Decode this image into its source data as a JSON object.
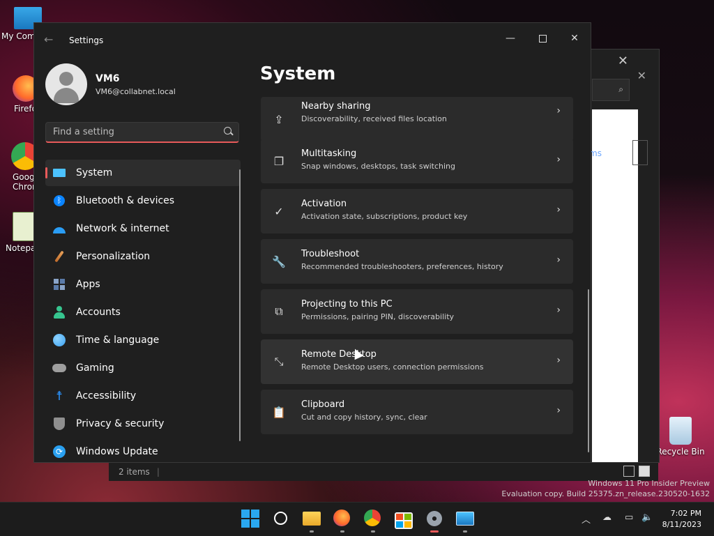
{
  "desktop": {
    "icons": [
      {
        "label": "My Com"
      },
      {
        "label": "Firefo"
      },
      {
        "label": "Goog\nChron"
      },
      {
        "label": "Notepa"
      }
    ],
    "recycle_bin": "Recycle Bin"
  },
  "background_window": {
    "link_text": "ms",
    "status_items": "2 items"
  },
  "settings": {
    "window_title": "Settings",
    "profile": {
      "name": "VM6",
      "email": "VM6@collabnet.local"
    },
    "search": {
      "placeholder": "Find a setting"
    },
    "nav": [
      {
        "label": "System",
        "icon": "monitor-icon",
        "active": true,
        "color": "#4cc2ff"
      },
      {
        "label": "Bluetooth & devices",
        "icon": "bluetooth-icon",
        "color": "#0a84ff"
      },
      {
        "label": "Network & internet",
        "icon": "wifi-icon",
        "color": "#2a9df4"
      },
      {
        "label": "Personalization",
        "icon": "paintbrush-icon",
        "color": "#e8a25a"
      },
      {
        "label": "Apps",
        "icon": "apps-icon",
        "color": "#8aa4c8"
      },
      {
        "label": "Accounts",
        "icon": "person-icon",
        "color": "#36c58f"
      },
      {
        "label": "Time & language",
        "icon": "globe-clock-icon",
        "color": "#3aa0f0"
      },
      {
        "label": "Gaming",
        "icon": "gamepad-icon",
        "color": "#9e9e9e"
      },
      {
        "label": "Accessibility",
        "icon": "accessibility-icon",
        "color": "#2a8cf0"
      },
      {
        "label": "Privacy & security",
        "icon": "shield-icon",
        "color": "#8f8f8f"
      },
      {
        "label": "Windows Update",
        "icon": "update-icon",
        "color": "#2aa0f0"
      }
    ],
    "page_title": "System",
    "cards": [
      {
        "title": "Nearby sharing",
        "subtitle": "Discoverability, received files location",
        "icon": "share-icon",
        "glyph": "⇪"
      },
      {
        "title": "Multitasking",
        "subtitle": "Snap windows, desktops, task switching",
        "icon": "multitasking-icon",
        "glyph": "❐"
      },
      {
        "title": "Activation",
        "subtitle": "Activation state, subscriptions, product key",
        "icon": "activation-icon",
        "glyph": "✓"
      },
      {
        "title": "Troubleshoot",
        "subtitle": "Recommended troubleshooters, preferences, history",
        "icon": "wrench-icon",
        "glyph": "🔧"
      },
      {
        "title": "Projecting to this PC",
        "subtitle": "Permissions, pairing PIN, discoverability",
        "icon": "projecting-icon",
        "glyph": "⧉"
      },
      {
        "title": "Remote Desktop",
        "subtitle": "Remote Desktop users, connection permissions",
        "icon": "remote-desktop-icon",
        "glyph": "⤡"
      },
      {
        "title": "Clipboard",
        "subtitle": "Cut and copy history, sync, clear",
        "icon": "clipboard-icon",
        "glyph": "📋"
      }
    ]
  },
  "watermark": {
    "line1": "Windows 11 Pro Insider Preview",
    "line2": "Evaluation copy. Build 25375.zn_release.230520-1632"
  },
  "taskbar": {
    "apps": [
      "start",
      "search",
      "file-explorer",
      "firefox",
      "chrome",
      "store",
      "settings",
      "remote-desktop-connection"
    ],
    "clock": {
      "time": "7:02 PM",
      "date": "8/11/2023"
    }
  },
  "colors": {
    "accent": "#e85a5a",
    "window_bg": "#1f1f1f",
    "card_bg": "#2b2b2b"
  }
}
